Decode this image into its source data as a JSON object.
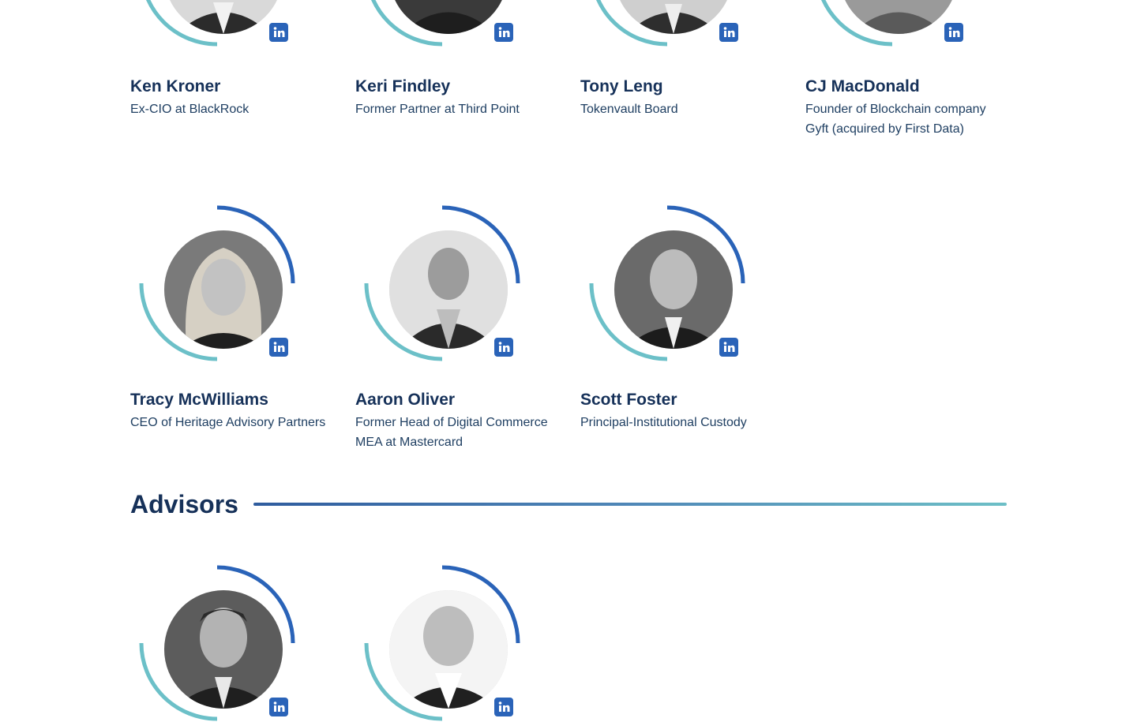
{
  "colors": {
    "ring_dark": "#2a63b8",
    "ring_light": "#6cc0c8",
    "heading": "#163159",
    "linkedin": "#2a63b8"
  },
  "board": [
    {
      "name": "Ken Kroner",
      "role": "Ex-CIO at BlackRock"
    },
    {
      "name": "Keri Findley",
      "role": "Former Partner at Third Point"
    },
    {
      "name": "Tony Leng",
      "role": "Tokenvault Board"
    },
    {
      "name": "CJ MacDonald",
      "role": "Founder of Blockchain company Gyft (acquired by First Data)"
    },
    {
      "name": "Tracy McWilliams",
      "role": "CEO of Heritage Advisory Partners"
    },
    {
      "name": "Aaron Oliver",
      "role": "Former Head of Digital Commerce MEA at Mastercard"
    },
    {
      "name": "Scott Foster",
      "role": "Principal-Institutional Custody"
    }
  ],
  "advisors_section": {
    "title": "Advisors"
  },
  "icons": {
    "linkedin": "linkedin-icon"
  }
}
